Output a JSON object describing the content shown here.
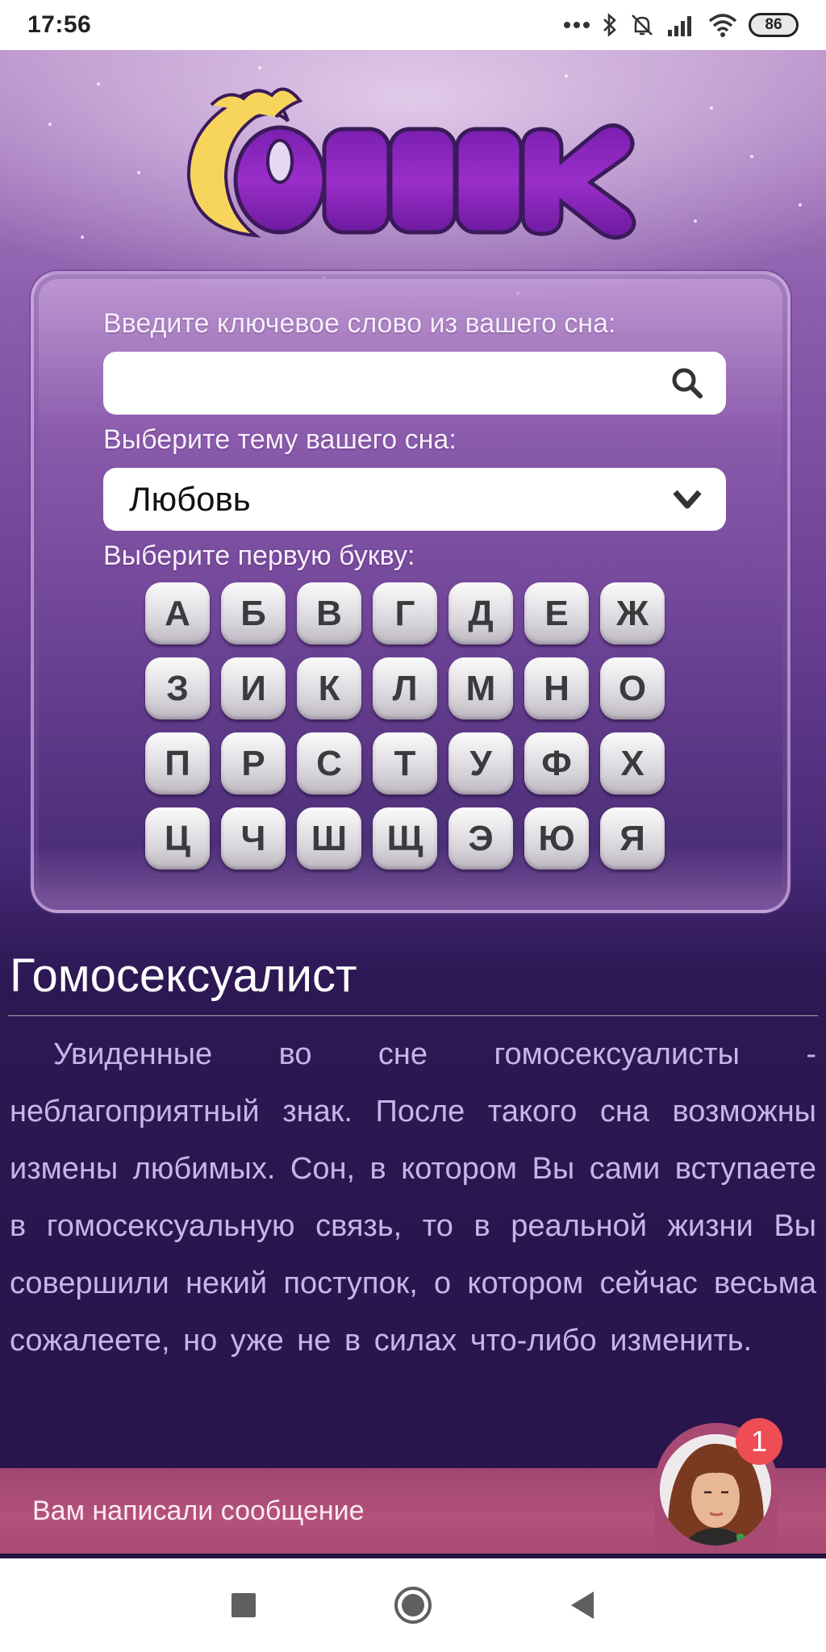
{
  "status_bar": {
    "time": "17:56",
    "icons": [
      "more-dots-icon",
      "bluetooth-icon",
      "bell-muted-icon",
      "signal-icon",
      "wifi-icon"
    ],
    "battery": "86"
  },
  "app": {
    "logo_text": "Сонник",
    "colors": {
      "accent_purple": "#8a2bc2",
      "moon_yellow": "#f7d55c",
      "banner_pink": "#a84a74",
      "badge_red": "#ee4d55"
    }
  },
  "search": {
    "keyword_label": "Введите ключевое слово из вашего сна:",
    "keyword_value": "",
    "keyword_placeholder": "",
    "search_icon": "search-icon",
    "theme_label": "Выберите тему вашего сна:",
    "theme_selected": "Любовь",
    "theme_icon": "chevron-down-icon",
    "letter_label": "Выберите первую букву:",
    "letters": [
      "А",
      "Б",
      "В",
      "Г",
      "Д",
      "Е",
      "Ж",
      "З",
      "И",
      "К",
      "Л",
      "М",
      "Н",
      "О",
      "П",
      "Р",
      "С",
      "Т",
      "У",
      "Ф",
      "Х",
      "Ц",
      "Ч",
      "Ш",
      "Щ",
      "Э",
      "Ю",
      "Я"
    ]
  },
  "article": {
    "title": "Гомосексуалист",
    "body": "Увиденные во сне гомосексуалисты - неблагоприятный знак. После такого сна возможны измены любимых. Сон, в котором Вы сами вступаете в гомосексуальную связь, то в реальной жизни Вы совершили некий поступок, о котором сейчас весьма сожалеете, но уже не в силах что-либо изменить."
  },
  "message_banner": {
    "text": "Вам написали сообщение",
    "badge_count": "1"
  },
  "nav_bar": {
    "buttons": [
      "recents-button",
      "home-button",
      "back-button"
    ]
  }
}
